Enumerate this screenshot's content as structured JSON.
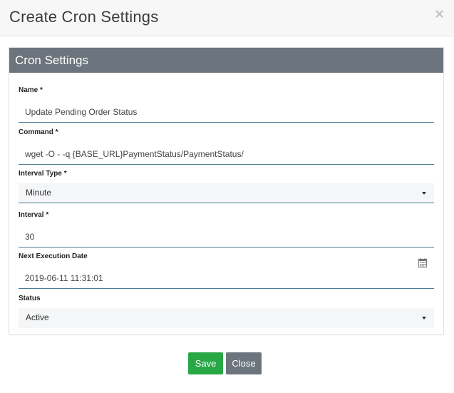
{
  "modal": {
    "title": "Create Cron Settings",
    "close_glyph": "×"
  },
  "card": {
    "title": "Cron Settings"
  },
  "fields": {
    "name": {
      "label": "Name *",
      "value": "Update Pending Order Status"
    },
    "command": {
      "label": "Command *",
      "value": "wget -O - -q {BASE_URL}PaymentStatus/PaymentStatus/"
    },
    "interval_type": {
      "label": "Interval Type *",
      "value": "Minute"
    },
    "interval": {
      "label": "Interval *",
      "value": "30"
    },
    "next_execution_date": {
      "label": "Next Execution Date",
      "value": "2019-06-11 11:31:01"
    },
    "status": {
      "label": "Status",
      "value": "Active"
    }
  },
  "buttons": {
    "save": "Save",
    "close": "Close"
  },
  "icons": {
    "close": "close-icon",
    "calendar": "calendar-icon",
    "dropdown": "caret-down-icon"
  },
  "colors": {
    "card_header_bg": "#6c757d",
    "save_button": "#28a745",
    "close_button": "#6c757d",
    "input_underline": "#4a7a93"
  }
}
